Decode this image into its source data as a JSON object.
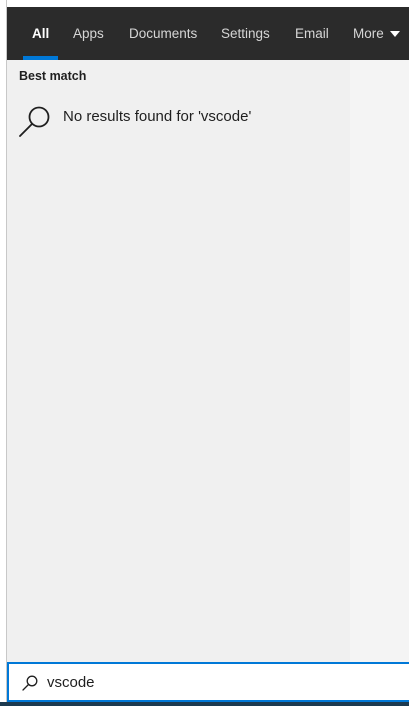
{
  "tabs": [
    {
      "label": "All",
      "active": true
    },
    {
      "label": "Apps",
      "active": false
    },
    {
      "label": "Documents",
      "active": false
    },
    {
      "label": "Settings",
      "active": false
    },
    {
      "label": "Email",
      "active": false
    },
    {
      "label": "More",
      "active": false
    }
  ],
  "results": {
    "section_label": "Best match",
    "message": "No results found for 'vscode'",
    "icon": "search-icon"
  },
  "search": {
    "value": "vscode",
    "icon": "search-icon"
  },
  "colors": {
    "tabbar_bg": "#2b2b2b",
    "accent": "#0078d7",
    "results_bg": "#f0f0f0"
  }
}
